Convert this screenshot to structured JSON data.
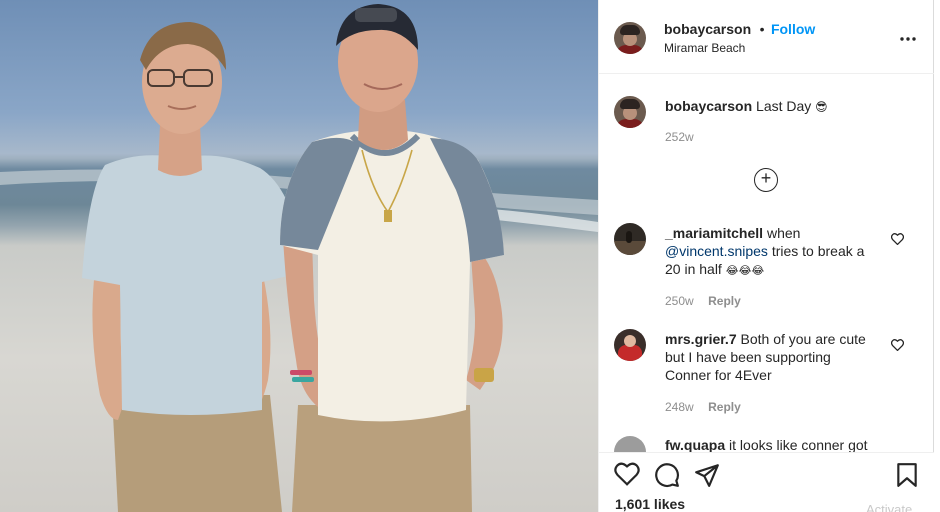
{
  "post": {
    "username": "bobaycarson",
    "follow_label": "Follow",
    "separator": "•",
    "location": "Miramar Beach",
    "more_icon": "more-options-icon"
  },
  "caption": {
    "username": "bobaycarson",
    "text": "Last Day",
    "emoji": "😎",
    "time": "252w"
  },
  "load_more_icon": "plus-circle-icon",
  "comments": [
    {
      "username": "_mariamitchell",
      "text_before": "when",
      "mention": "@vincent.snipes",
      "text_after": "tries to break a 20 in half",
      "emojis": "😂😂😂",
      "time": "250w",
      "reply_label": "Reply"
    },
    {
      "username": "mrs.grier.7",
      "text": "Both of you are cute but I have been supporting Conner for 4Ever",
      "time": "248w",
      "reply_label": "Reply"
    },
    {
      "username": "fw.quapa",
      "text": "it looks like conner got"
    }
  ],
  "actions": {
    "like_icon": "heart-icon",
    "comment_icon": "comment-icon",
    "share_icon": "paper-plane-icon",
    "save_icon": "bookmark-icon",
    "likes_text": "1,601 likes"
  },
  "watermark": "Activate",
  "colors": {
    "link_blue": "#0095f6",
    "mention_blue": "#00376b",
    "muted": "#8e8e8e",
    "text": "#262626"
  }
}
